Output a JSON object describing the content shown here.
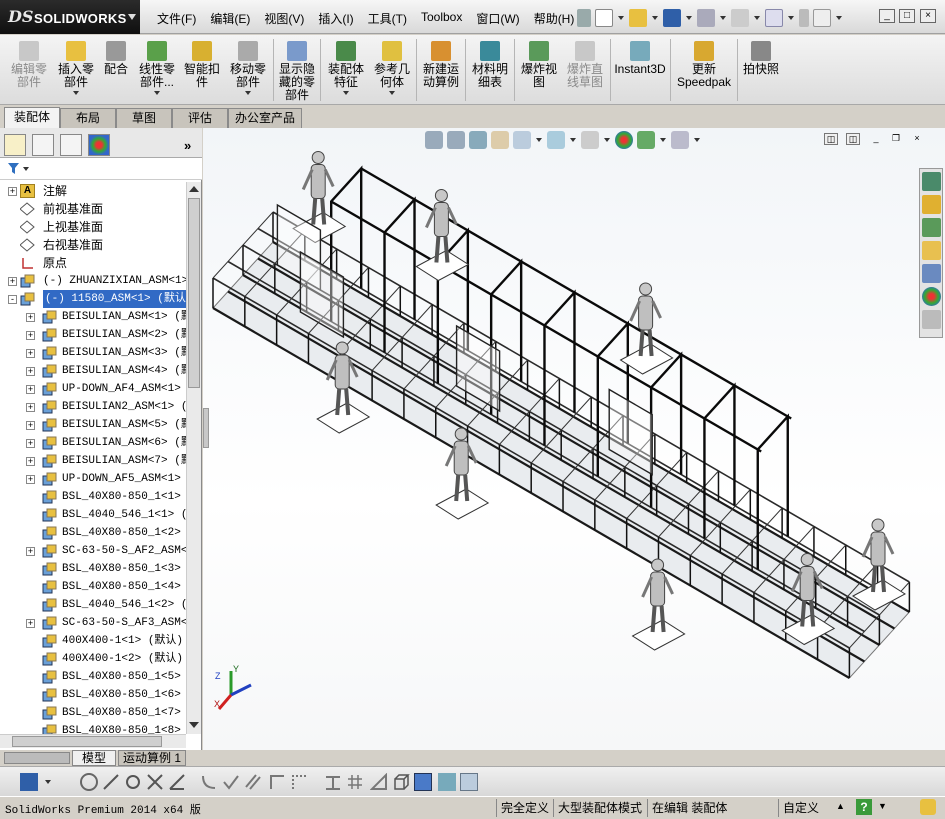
{
  "app": {
    "logo_ds": "DS",
    "logo_name": "SOLIDWORKS",
    "menu": [
      "文件(F)",
      "编辑(E)",
      "视图(V)",
      "插入(I)",
      "工具(T)",
      "Toolbox",
      "窗口(W)",
      "帮助(H)"
    ]
  },
  "commands": [
    {
      "label": "编辑零部件",
      "disabled": true
    },
    {
      "label": "插入零部件",
      "disabled": false
    },
    {
      "label": "配合",
      "disabled": false
    },
    {
      "label": "线性零部件...",
      "disabled": false
    },
    {
      "label": "智能扣件",
      "disabled": false
    },
    {
      "label": "移动零部件",
      "disabled": false
    },
    {
      "label": "显示隐藏的零部件",
      "disabled": false
    },
    {
      "label": "装配体特征",
      "disabled": false
    },
    {
      "label": "参考几何体",
      "disabled": false
    },
    {
      "label": "新建运动算例",
      "disabled": false
    },
    {
      "label": "材料明细表",
      "disabled": false
    },
    {
      "label": "爆炸视图",
      "disabled": false
    },
    {
      "label": "爆炸直线草图",
      "disabled": true
    },
    {
      "label": "Instant3D",
      "disabled": false
    },
    {
      "label": "更新Speedpak",
      "disabled": false
    },
    {
      "label": "拍快照",
      "disabled": false
    }
  ],
  "tabs": [
    "装配体",
    "布局",
    "草图",
    "评估",
    "办公室产品"
  ],
  "tree": [
    {
      "label": "注解",
      "expand": "+",
      "icon": "annotation-icon",
      "mono": false
    },
    {
      "label": "前视基准面",
      "expand": "",
      "icon": "plane-icon",
      "mono": false
    },
    {
      "label": "上视基准面",
      "expand": "",
      "icon": "plane-icon",
      "mono": false
    },
    {
      "label": "右视基准面",
      "expand": "",
      "icon": "plane-icon",
      "mono": false
    },
    {
      "label": "原点",
      "expand": "",
      "icon": "origin-icon",
      "mono": false
    },
    {
      "label": "(-) ZHUANZIXIAN_ASM<1> (",
      "expand": "+",
      "icon": "assembly-icon",
      "mono": true
    },
    {
      "label": "(-) 11580_ASM<1> (默认)",
      "expand": "-",
      "icon": "assembly-icon",
      "mono": true,
      "selected": true
    },
    {
      "label": "BEISULIAN_ASM<1> (默认",
      "expand": "+",
      "icon": "assembly-icon",
      "mono": true
    },
    {
      "label": "BEISULIAN_ASM<2> (默认",
      "expand": "+",
      "icon": "assembly-icon",
      "mono": true
    },
    {
      "label": "BEISULIAN_ASM<3> (默认",
      "expand": "+",
      "icon": "assembly-icon",
      "mono": true
    },
    {
      "label": "BEISULIAN_ASM<4> (默认",
      "expand": "+",
      "icon": "assembly-icon",
      "mono": true
    },
    {
      "label": "UP-DOWN_AF4_ASM<1> (",
      "expand": "+",
      "icon": "assembly-icon",
      "mono": true
    },
    {
      "label": "BEISULIAN2_ASM<1> (默",
      "expand": "+",
      "icon": "assembly-icon",
      "mono": true
    },
    {
      "label": "BEISULIAN_ASM<5> (默认",
      "expand": "+",
      "icon": "assembly-icon",
      "mono": true
    },
    {
      "label": "BEISULIAN_ASM<6> (默认",
      "expand": "+",
      "icon": "assembly-icon",
      "mono": true
    },
    {
      "label": "BEISULIAN_ASM<7> (默认",
      "expand": "+",
      "icon": "assembly-icon",
      "mono": true
    },
    {
      "label": "UP-DOWN_AF5_ASM<1> (",
      "expand": "+",
      "icon": "assembly-icon",
      "mono": true
    },
    {
      "label": "BSL_40X80-850_1<1> (",
      "expand": "",
      "icon": "assembly-icon",
      "mono": true
    },
    {
      "label": "BSL_4040_546_1<1> (默",
      "expand": "",
      "icon": "assembly-icon",
      "mono": true
    },
    {
      "label": "BSL_40X80-850_1<2> (",
      "expand": "",
      "icon": "assembly-icon",
      "mono": true
    },
    {
      "label": "SC-63-50-S_AF2_ASM<1>",
      "expand": "+",
      "icon": "assembly-icon",
      "mono": true
    },
    {
      "label": "BSL_40X80-850_1<3> (",
      "expand": "",
      "icon": "assembly-icon",
      "mono": true
    },
    {
      "label": "BSL_40X80-850_1<4> (",
      "expand": "",
      "icon": "assembly-icon",
      "mono": true
    },
    {
      "label": "BSL_4040_546_1<2> (默",
      "expand": "",
      "icon": "assembly-icon",
      "mono": true
    },
    {
      "label": "SC-63-50-S_AF3_ASM<1>",
      "expand": "+",
      "icon": "assembly-icon",
      "mono": true
    },
    {
      "label": "400X400-1<1> (默认)",
      "expand": "",
      "icon": "assembly-icon",
      "mono": true
    },
    {
      "label": "400X400-1<2> (默认)",
      "expand": "",
      "icon": "assembly-icon",
      "mono": true
    },
    {
      "label": "BSL_40X80-850_1<5> (",
      "expand": "",
      "icon": "assembly-icon",
      "mono": true
    },
    {
      "label": "BSL_40X80-850_1<6> (",
      "expand": "",
      "icon": "assembly-icon",
      "mono": true
    },
    {
      "label": "BSL_40X80-850_1<7> (",
      "expand": "",
      "icon": "assembly-icon",
      "mono": true
    },
    {
      "label": "BSL_40X80-850_1<8> (",
      "expand": "",
      "icon": "assembly-icon",
      "mono": true
    }
  ],
  "bottom_tabs": [
    "模型",
    "运动算例 1"
  ],
  "status": {
    "app_version": "SolidWorks Premium 2014 x64 版",
    "defined": "完全定义",
    "mode": "大型装配体模式",
    "editing": "在编辑 装配体",
    "units": "自定义"
  },
  "triad": {
    "x": "X",
    "y": "Y",
    "z": "Z"
  },
  "colors": {
    "accent": "#316ac5",
    "icon_blue": "#2f6fbf",
    "icon_green": "#3a9a3a",
    "icon_yellow": "#e8b923",
    "icon_red": "#c83232"
  }
}
